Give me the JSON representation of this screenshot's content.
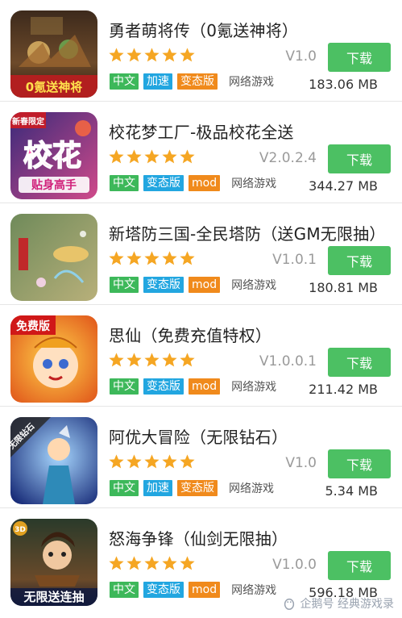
{
  "apps": [
    {
      "title": "勇者萌将传（0氪送神将）",
      "version": "V1.0",
      "download_label": "下载",
      "tags": [
        {
          "label": "中文",
          "color": "green"
        },
        {
          "label": "加速",
          "color": "blue"
        },
        {
          "label": "变态版",
          "color": "orange"
        }
      ],
      "category": "网络游戏",
      "size": "183.06 MB",
      "rating": 5,
      "icon_text": "0氪送神将",
      "icon_name": "game-icon-yongzhe"
    },
    {
      "title": "校花梦工厂-极品校花全送",
      "version": "V2.0.2.4",
      "download_label": "下载",
      "tags": [
        {
          "label": "中文",
          "color": "green"
        },
        {
          "label": "变态版",
          "color": "blue"
        },
        {
          "label": "mod",
          "color": "orange"
        }
      ],
      "category": "网络游戏",
      "size": "344.27 MB",
      "rating": 5,
      "icon_text": "校花",
      "icon_subtext": "贴身高手",
      "icon_badge": "新春限定",
      "icon_name": "game-icon-xiaohua"
    },
    {
      "title": "新塔防三国-全民塔防（送GM无限抽）",
      "version": "V1.0.1",
      "download_label": "下载",
      "tags": [
        {
          "label": "中文",
          "color": "green"
        },
        {
          "label": "变态版",
          "color": "blue"
        },
        {
          "label": "mod",
          "color": "orange"
        }
      ],
      "category": "网络游戏",
      "size": "180.81 MB",
      "rating": 5,
      "icon_name": "game-icon-tafang"
    },
    {
      "title": "思仙（免费充值特权）",
      "version": "V1.0.0.1",
      "download_label": "下载",
      "tags": [
        {
          "label": "中文",
          "color": "green"
        },
        {
          "label": "变态版",
          "color": "blue"
        },
        {
          "label": "mod",
          "color": "orange"
        }
      ],
      "category": "网络游戏",
      "size": "211.42 MB",
      "rating": 5,
      "icon_badge": "免费版",
      "icon_name": "game-icon-sixian"
    },
    {
      "title": "阿优大冒险（无限钻石）",
      "version": "V1.0",
      "download_label": "下载",
      "tags": [
        {
          "label": "中文",
          "color": "green"
        },
        {
          "label": "加速",
          "color": "blue"
        },
        {
          "label": "变态版",
          "color": "orange"
        }
      ],
      "category": "网络游戏",
      "size": "5.34 MB",
      "rating": 5,
      "icon_badge": "无限钻石",
      "icon_name": "game-icon-ayou"
    },
    {
      "title": "怒海争锋（仙剑无限抽）",
      "version": "V1.0.0",
      "download_label": "下载",
      "tags": [
        {
          "label": "中文",
          "color": "green"
        },
        {
          "label": "变态版",
          "color": "blue"
        },
        {
          "label": "mod",
          "color": "orange"
        }
      ],
      "category": "网络游戏",
      "size": "596.18 MB",
      "rating": 5,
      "icon_text": "无限送连抽",
      "icon_badge": "3D",
      "icon_name": "game-icon-nuhai"
    }
  ],
  "watermark": "企鹅号 经典游戏录",
  "colors": {
    "download_button": "#4cc063",
    "tag_green": "#3db85a",
    "tag_blue": "#22a6e0",
    "tag_orange": "#f08a1c",
    "star": "#f5a623"
  }
}
